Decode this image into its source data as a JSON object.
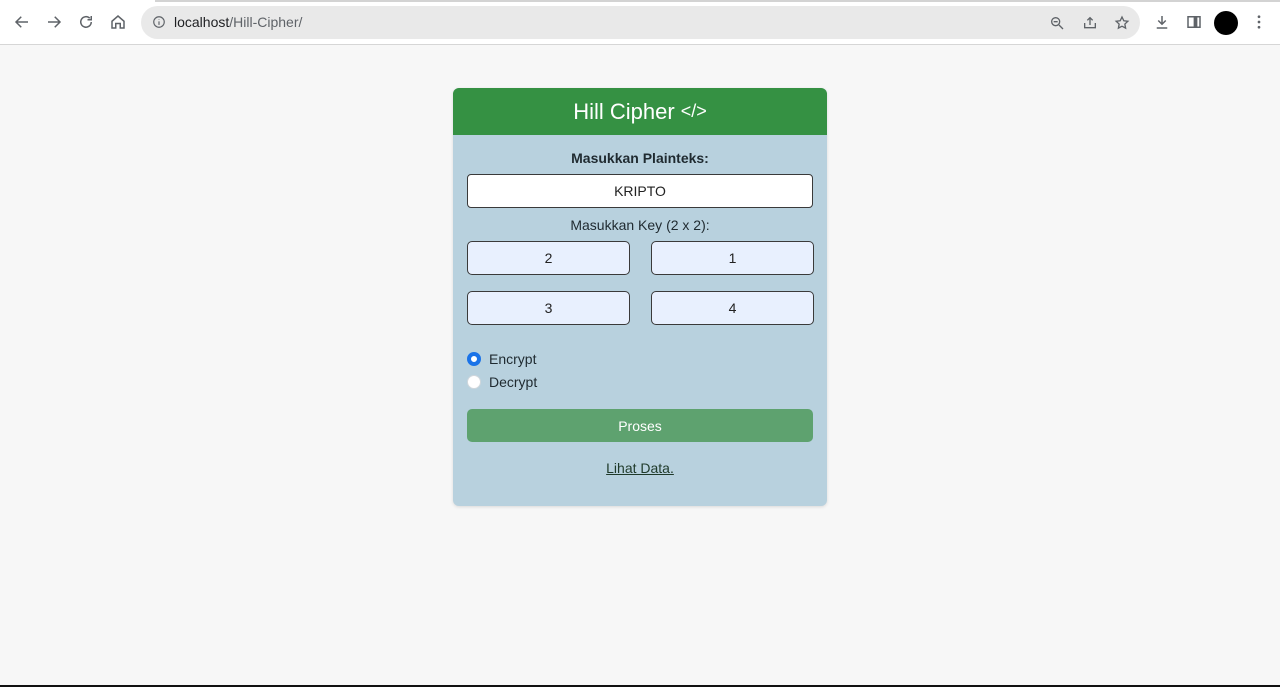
{
  "browser": {
    "url_host": "localhost",
    "url_path": "/Hill-Cipher/"
  },
  "card": {
    "title": "Hill Cipher",
    "title_icon": "</>",
    "plaintext_label": "Masukkan Plainteks:",
    "plaintext_value": "KRIPTO",
    "key_label": "Masukkan Key (2 x 2):",
    "key": [
      "2",
      "1",
      "3",
      "4"
    ],
    "radio_encrypt": "Encrypt",
    "radio_decrypt": "Decrypt",
    "selected_mode": "Encrypt",
    "submit_label": "Proses",
    "link_label": "Lihat Data."
  },
  "colors": {
    "header": "#359143",
    "card_bg": "#b8d1de",
    "button": "#5ea26f",
    "radio_checked": "#1a73e8"
  }
}
